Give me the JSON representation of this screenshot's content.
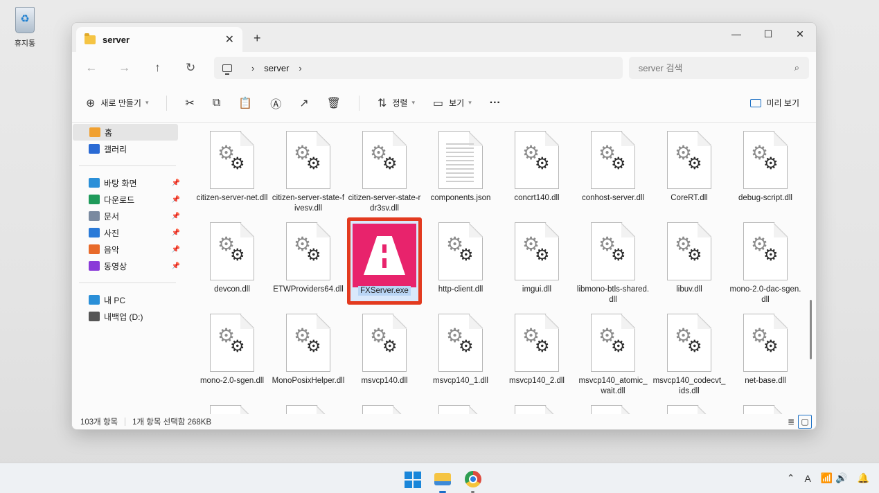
{
  "desktop": {
    "recycle_bin_label": "휴지통"
  },
  "window": {
    "tab_title": "server",
    "new_tab": "+",
    "controls": {
      "minimize": "—",
      "maximize": "☐",
      "close": "✕"
    }
  },
  "nav": {
    "back": "←",
    "forward": "→",
    "up": "↑",
    "refresh": "↻",
    "breadcrumb": [
      "server"
    ],
    "search_placeholder": "server 검색"
  },
  "toolbar": {
    "new_label": "새로 만들기",
    "sort_label": "정렬",
    "view_label": "보기",
    "more": "···",
    "preview_label": "미리 보기"
  },
  "sidebar": {
    "items": [
      {
        "label": "홈",
        "icon": "home-icon",
        "color": "#f0a030",
        "active": true
      },
      {
        "label": "갤러리",
        "icon": "gallery-icon",
        "color": "#2a6ad4"
      }
    ],
    "quick_access": [
      {
        "label": "바탕 화면",
        "icon": "desktop-icon",
        "color": "#2a8fd8",
        "pinned": true
      },
      {
        "label": "다운로드",
        "icon": "download-icon",
        "color": "#1e9a5a",
        "pinned": true
      },
      {
        "label": "문서",
        "icon": "documents-icon",
        "color": "#7a8aa0",
        "pinned": true
      },
      {
        "label": "사진",
        "icon": "pictures-icon",
        "color": "#2a7ad8",
        "pinned": true
      },
      {
        "label": "음악",
        "icon": "music-icon",
        "color": "#e86a2a",
        "pinned": true
      },
      {
        "label": "동영상",
        "icon": "videos-icon",
        "color": "#8a3ad8",
        "pinned": true
      }
    ],
    "drives": [
      {
        "label": "내 PC",
        "icon": "this-pc-icon",
        "color": "#2a8fd8"
      },
      {
        "label": "내백업 (D:)",
        "icon": "drive-icon",
        "color": "#555555"
      }
    ]
  },
  "files": [
    {
      "name": "citizen-server-net.dll",
      "type": "dll"
    },
    {
      "name": "citizen-server-state-fivesv.dll",
      "type": "dll"
    },
    {
      "name": "citizen-server-state-rdr3sv.dll",
      "type": "dll"
    },
    {
      "name": "components.json",
      "type": "json"
    },
    {
      "name": "concrt140.dll",
      "type": "dll"
    },
    {
      "name": "conhost-server.dll",
      "type": "dll"
    },
    {
      "name": "CoreRT.dll",
      "type": "dll"
    },
    {
      "name": "debug-script.dll",
      "type": "dll"
    },
    {
      "name": "devcon.dll",
      "type": "dll"
    },
    {
      "name": "ETWProviders64.dll",
      "type": "dll"
    },
    {
      "name": "FXServer.exe",
      "type": "exe",
      "selected": true
    },
    {
      "name": "http-client.dll",
      "type": "dll"
    },
    {
      "name": "imgui.dll",
      "type": "dll"
    },
    {
      "name": "libmono-btls-shared.dll",
      "type": "dll"
    },
    {
      "name": "libuv.dll",
      "type": "dll"
    },
    {
      "name": "mono-2.0-dac-sgen.dll",
      "type": "dll"
    },
    {
      "name": "mono-2.0-sgen.dll",
      "type": "dll"
    },
    {
      "name": "MonoPosixHelper.dll",
      "type": "dll"
    },
    {
      "name": "msvcp140.dll",
      "type": "dll"
    },
    {
      "name": "msvcp140_1.dll",
      "type": "dll"
    },
    {
      "name": "msvcp140_2.dll",
      "type": "dll"
    },
    {
      "name": "msvcp140_atomic_wait.dll",
      "type": "dll"
    },
    {
      "name": "msvcp140_codecvt_ids.dll",
      "type": "dll"
    },
    {
      "name": "net-base.dll",
      "type": "dll"
    },
    {
      "name": "",
      "type": "dll"
    },
    {
      "name": "",
      "type": "dll"
    },
    {
      "name": "",
      "type": "dll"
    },
    {
      "name": "",
      "type": "dll"
    },
    {
      "name": "",
      "type": "dll"
    },
    {
      "name": "",
      "type": "dll"
    },
    {
      "name": "",
      "type": "dll"
    },
    {
      "name": "",
      "type": "dll"
    }
  ],
  "status": {
    "item_count": "103개 항목",
    "selection": "1개 항목 선택함 268KB"
  },
  "colors": {
    "accent": "#1b6fc4",
    "selection_highlight": "#e33a1f",
    "fxserver_icon": "#e8236c"
  }
}
